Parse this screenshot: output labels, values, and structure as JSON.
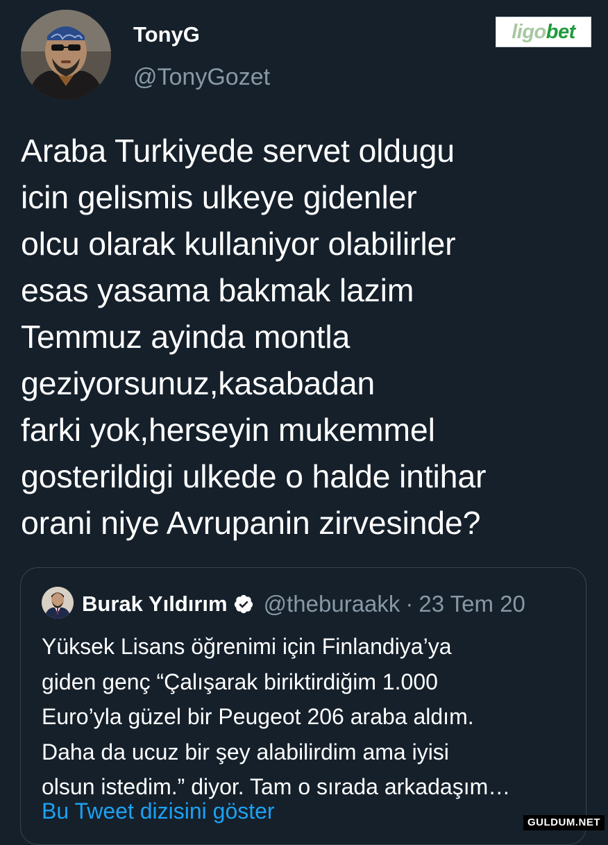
{
  "author": {
    "display_name": "TonyG",
    "handle": "@TonyGozet",
    "avatar_icon": "profile-photo"
  },
  "brand_logo": {
    "text": "ligobet",
    "color": "#1e9b3c"
  },
  "tweet": {
    "text": "Araba Turkiyede servet oldugu\nicin gelismis ulkeye gidenler\nolcu olarak kullaniyor olabilirler\nesas yasama bakmak lazim\nTemmuz ayinda montla\ngeziyorsunuz,kasabadan\nfarki yok,herseyin mukemmel\ngosterildigi ulkede o halde intihar\norani niye Avrupanin  zirvesinde?"
  },
  "quoted_tweet": {
    "display_name": "Burak Yıldırım",
    "verified_icon": "verified-badge-icon",
    "handle": "@theburaakk",
    "separator": "·",
    "date": "23 Tem 20",
    "text": "Yüksek Lisans öğrenimi için Finlandiya’ya\ngiden genç “Çalışarak biriktirdiğim 1.000\nEuro’yla güzel bir Peugeot 206 araba aldım.\nDaha da ucuz bir şey alabilirdim ama iyisi\nolsun istedim.” diyor. Tam o sırada arkadaşım…",
    "show_thread_link": "Bu Tweet dizisini göster"
  },
  "watermark": "GULDUM.NET",
  "colors": {
    "background": "#15202b",
    "text_primary": "#ffffff",
    "text_secondary": "#8899a6",
    "link": "#1da1f2",
    "card_border": "#38444d"
  }
}
